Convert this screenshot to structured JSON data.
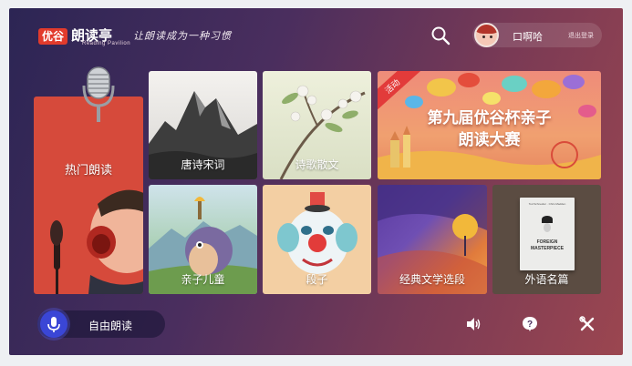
{
  "header": {
    "logo_badge": "优谷",
    "logo_main": "朗读亭",
    "logo_sub": "Reading Pavilion",
    "slogan": "让朗读成为一种习惯",
    "search_icon": "search-icon",
    "user": {
      "name": "口啊哈",
      "logout_label": "退出登录"
    }
  },
  "tiles": {
    "popular": "热门朗读",
    "tang": "唐诗宋词",
    "poem": "诗歌散文",
    "event": {
      "badge": "活动",
      "title_line1": "第九届优谷杯亲子",
      "title_line2": "朗读大赛"
    },
    "kids": "亲子儿童",
    "joke": "段子",
    "classic": "经典文学选段",
    "foreign": "外语名篇",
    "foreign_book": {
      "authors": "Tod Schneider  ·  Chris Madden",
      "title_line1": "FOREIGN",
      "title_line2": "MASTERPIECE"
    }
  },
  "bottom": {
    "free_read_label": "自由朗读",
    "icons": [
      "volume-icon",
      "help-icon",
      "tools-icon"
    ]
  },
  "colors": {
    "accent_red": "#e23b2c",
    "mic_blue": "#3a46d6"
  }
}
